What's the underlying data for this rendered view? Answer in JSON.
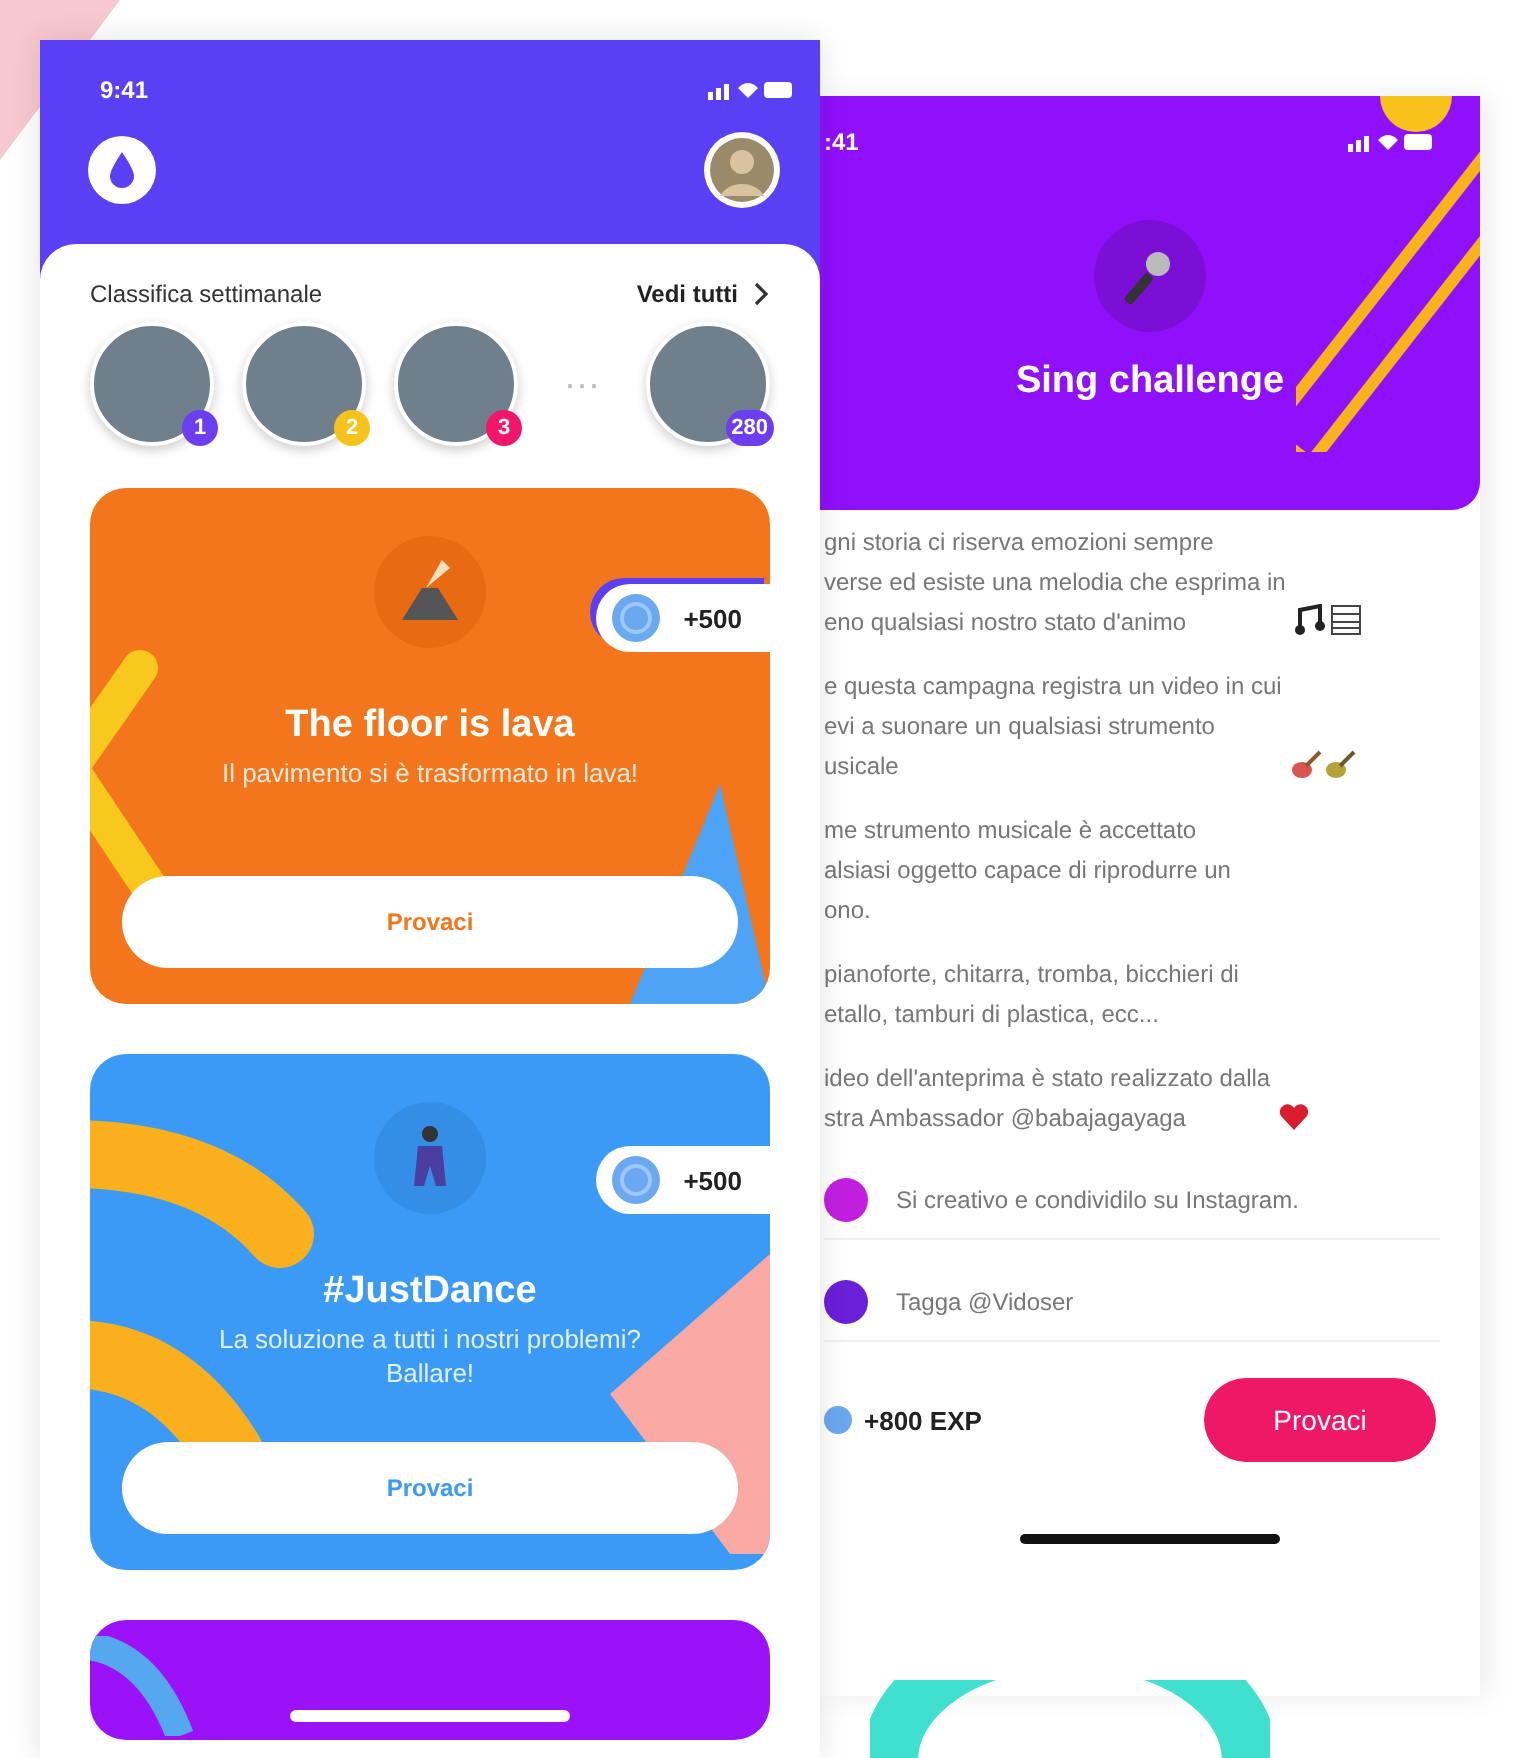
{
  "home_screen": {
    "status_time": "9:41",
    "leaderboard": {
      "title": "Classifica settimanale",
      "see_all": "Vedi tutti",
      "separator": "···",
      "entries": [
        {
          "rank": "1",
          "color": "#6c3ef0"
        },
        {
          "rank": "2",
          "color": "#f6c21c"
        },
        {
          "rank": "3",
          "color": "#f0176a"
        },
        {
          "rank": "280",
          "color": "#6c3ef0"
        }
      ]
    },
    "challenges": [
      {
        "kind": "lava",
        "title": "The floor is lava",
        "subtitle": "Il pavimento si è trasformato in lava!",
        "points": "+500",
        "button": "Provaci",
        "color": "#f3761c"
      },
      {
        "kind": "dance",
        "title": "#JustDance",
        "subtitle": "La soluzione a tutti i nostri problemi? Ballare!",
        "points": "+500",
        "button": "Provaci",
        "color": "#3a9af5"
      },
      {
        "kind": "partial",
        "color": "#9b12f8"
      }
    ]
  },
  "detail_screen": {
    "status_time": ":41",
    "title": "Sing challenge",
    "paragraphs": [
      "gni storia ci riserva emozioni sempre\nverse ed esiste una melodia che esprima in\neno qualsiasi nostro stato d'animo",
      "e questa campagna registra un video in cui\nevi a suonare un qualsiasi strumento\nusicale",
      "me strumento musicale è accettato\nalsiasi oggetto capace di riprodurre un\nono.",
      "pianoforte, chitarra, tromba, bicchieri di\netallo, tamburi di plastica, ecc...",
      "ideo dell'anteprima è stato realizzato dalla\nstra Ambassador @babajagayaga"
    ],
    "steps": [
      {
        "text": "Si creativo e condividilo su Instagram.",
        "color": "#c21ee0"
      },
      {
        "text": "Tagga @Vidoser",
        "color": "#6a1fd8"
      }
    ],
    "reward": "+800 EXP",
    "button": "Provaci"
  }
}
